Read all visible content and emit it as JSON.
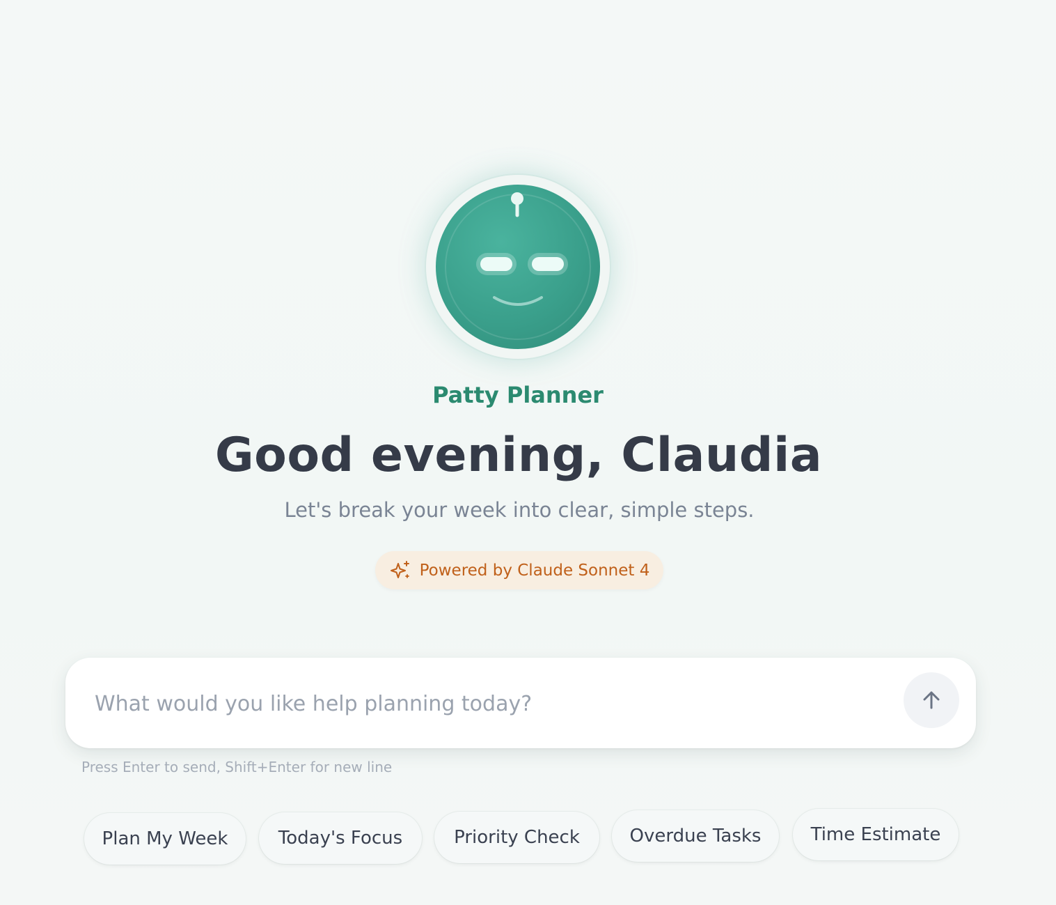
{
  "assistant": {
    "name": "Patty Planner"
  },
  "hero": {
    "greeting": "Good evening, Claudia",
    "subtitle": "Let's break your week into clear, simple steps."
  },
  "badge": {
    "label": "Powered by Claude Sonnet 4",
    "icon": "sparkle-icon",
    "color": "#c0601a"
  },
  "composer": {
    "placeholder": "What would you like help planning today?",
    "send_icon": "arrow-up-icon",
    "hint": "Press Enter to send, Shift+Enter for new line"
  },
  "quick_actions": [
    {
      "label": "Plan My Week"
    },
    {
      "label": "Today's Focus"
    },
    {
      "label": "Priority Check"
    },
    {
      "label": "Overdue Tasks"
    },
    {
      "label": "Time Estimate"
    }
  ],
  "colors": {
    "accent": "#2b8a70",
    "avatar": "#3a9f8b",
    "heading": "#353b48"
  }
}
